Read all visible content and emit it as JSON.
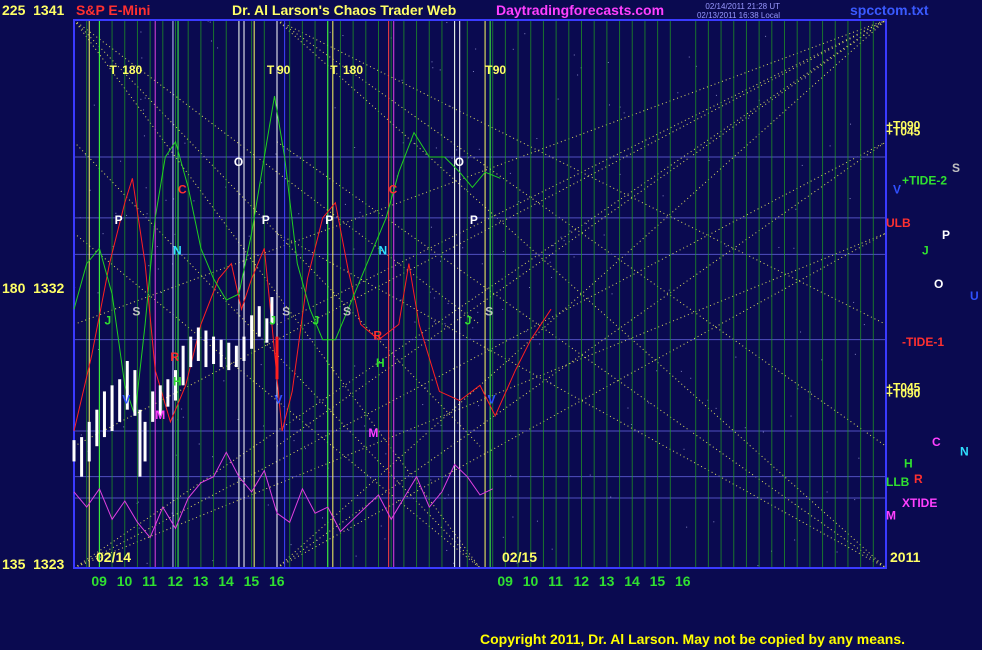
{
  "header": {
    "symbol": "S&P E-Mini",
    "title": "Dr. Al Larson's Chaos Trader Web",
    "site": "Daytradingforecasts.com",
    "timestamp_1": "02/14/2011 21:28 UT",
    "timestamp_2": "02/13/2011 16:38 Local",
    "filename": "spcctom.txt"
  },
  "y_labels": [
    {
      "angle": "225",
      "price": "1341"
    },
    {
      "angle": "180",
      "price": "1332"
    },
    {
      "angle": "135",
      "price": "1323"
    }
  ],
  "dates": [
    "02/14",
    "02/15"
  ],
  "year": "2011",
  "copyright": "Copyright 2011, Dr. Al Larson. May not be copied by any means.",
  "colors": {
    "background": "#0a0a50",
    "frame": "#3a3aff",
    "price_bar": "#ffffff",
    "price_down": "#ff2020",
    "red_line": "#ff2020",
    "green_line": "#20d020",
    "magenta_line": "#e040e0",
    "dotted_lines": "#e0e060",
    "hour_grid": "#20a020"
  },
  "chart_data": {
    "type": "bar",
    "ylim": [
      1323,
      1341
    ],
    "y_ticks": [
      1323,
      1332,
      1341
    ],
    "days": [
      "02/14",
      "02/15"
    ],
    "x_ticks": [
      "09",
      "10",
      "11",
      "12",
      "13",
      "14",
      "15",
      "16",
      "09",
      "10",
      "11",
      "12",
      "13",
      "14",
      "15",
      "16"
    ],
    "x_range_hours": [
      8.0,
      40.0
    ],
    "price_series": [
      {
        "t": 8.0,
        "low": 1326.5,
        "high": 1327.2
      },
      {
        "t": 8.3,
        "low": 1326.0,
        "high": 1327.3
      },
      {
        "t": 8.6,
        "low": 1326.5,
        "high": 1327.8
      },
      {
        "t": 8.9,
        "low": 1327.0,
        "high": 1328.2
      },
      {
        "t": 9.2,
        "low": 1327.3,
        "high": 1328.8
      },
      {
        "t": 9.5,
        "low": 1327.5,
        "high": 1329.0
      },
      {
        "t": 9.8,
        "low": 1327.8,
        "high": 1329.2
      },
      {
        "t": 10.1,
        "low": 1328.2,
        "high": 1329.8
      },
      {
        "t": 10.4,
        "low": 1328.0,
        "high": 1329.5
      },
      {
        "t": 10.6,
        "low": 1326.0,
        "high": 1328.2
      },
      {
        "t": 10.8,
        "low": 1326.5,
        "high": 1327.8
      },
      {
        "t": 11.1,
        "low": 1327.8,
        "high": 1328.8
      },
      {
        "t": 11.4,
        "low": 1328.0,
        "high": 1329.0
      },
      {
        "t": 11.7,
        "low": 1328.3,
        "high": 1329.2
      },
      {
        "t": 12.0,
        "low": 1328.5,
        "high": 1329.5
      },
      {
        "t": 12.3,
        "low": 1329.0,
        "high": 1330.3
      },
      {
        "t": 12.6,
        "low": 1329.6,
        "high": 1330.6
      },
      {
        "t": 12.9,
        "low": 1329.8,
        "high": 1330.9
      },
      {
        "t": 13.2,
        "low": 1329.6,
        "high": 1330.8
      },
      {
        "t": 13.5,
        "low": 1329.7,
        "high": 1330.6
      },
      {
        "t": 13.8,
        "low": 1329.6,
        "high": 1330.5
      },
      {
        "t": 14.1,
        "low": 1329.5,
        "high": 1330.4
      },
      {
        "t": 14.4,
        "low": 1329.6,
        "high": 1330.3
      },
      {
        "t": 14.7,
        "low": 1329.8,
        "high": 1330.6
      },
      {
        "t": 15.0,
        "low": 1330.2,
        "high": 1331.3
      },
      {
        "t": 15.3,
        "low": 1330.6,
        "high": 1331.6
      },
      {
        "t": 15.6,
        "low": 1330.4,
        "high": 1331.2
      },
      {
        "t": 15.8,
        "low": 1331.0,
        "high": 1331.9
      },
      {
        "t": 16.0,
        "low": 1329.2,
        "high": 1330.6
      }
    ],
    "series": [
      {
        "color": "red",
        "points": [
          [
            8.0,
            1327.5
          ],
          [
            8.7,
            1330.0
          ],
          [
            9.4,
            1333.0
          ],
          [
            10.0,
            1335.0
          ],
          [
            10.3,
            1335.8
          ],
          [
            10.8,
            1333.0
          ],
          [
            11.2,
            1329.5
          ],
          [
            11.8,
            1327.8
          ],
          [
            12.4,
            1329.0
          ],
          [
            13.0,
            1331.0
          ],
          [
            13.7,
            1332.5
          ],
          [
            14.2,
            1333.0
          ],
          [
            14.6,
            1331.5
          ],
          [
            15.0,
            1332.5
          ],
          [
            15.5,
            1333.5
          ],
          [
            15.8,
            1331.0
          ],
          [
            16.2,
            1327.5
          ],
          [
            16.6,
            1328.8
          ],
          [
            17.2,
            1332.5
          ],
          [
            17.8,
            1334.5
          ],
          [
            18.3,
            1335.0
          ],
          [
            18.8,
            1332.8
          ],
          [
            19.3,
            1331.0
          ],
          [
            20.0,
            1330.5
          ],
          [
            20.8,
            1331.0
          ],
          [
            21.2,
            1333.0
          ],
          [
            21.6,
            1331.0
          ],
          [
            22.4,
            1328.8
          ],
          [
            23.2,
            1328.5
          ],
          [
            24.0,
            1329.0
          ],
          [
            24.6,
            1328.0
          ],
          [
            25.4,
            1329.5
          ],
          [
            26.0,
            1330.5
          ],
          [
            26.8,
            1331.5
          ]
        ]
      },
      {
        "color": "green",
        "points": [
          [
            8.0,
            1331.5
          ],
          [
            8.5,
            1333.0
          ],
          [
            9.0,
            1333.5
          ],
          [
            9.5,
            1332.0
          ],
          [
            10.0,
            1329.0
          ],
          [
            10.4,
            1328.0
          ],
          [
            10.8,
            1331.0
          ],
          [
            11.2,
            1334.5
          ],
          [
            11.6,
            1336.5
          ],
          [
            12.0,
            1337.0
          ],
          [
            12.5,
            1335.5
          ],
          [
            13.0,
            1333.5
          ],
          [
            13.5,
            1332.5
          ],
          [
            14.0,
            1331.8
          ],
          [
            14.5,
            1332.0
          ],
          [
            15.0,
            1334.0
          ],
          [
            15.5,
            1336.5
          ],
          [
            15.9,
            1338.5
          ],
          [
            16.3,
            1336.5
          ],
          [
            16.8,
            1333.0
          ],
          [
            17.3,
            1331.5
          ],
          [
            17.8,
            1330.5
          ],
          [
            18.3,
            1330.5
          ],
          [
            18.8,
            1331.5
          ],
          [
            19.3,
            1332.5
          ],
          [
            19.8,
            1333.5
          ],
          [
            20.3,
            1334.5
          ],
          [
            20.8,
            1336.0
          ],
          [
            21.4,
            1337.3
          ],
          [
            22.0,
            1336.5
          ],
          [
            22.6,
            1336.5
          ],
          [
            23.2,
            1336.0
          ],
          [
            23.7,
            1335.5
          ],
          [
            24.2,
            1336.0
          ],
          [
            24.8,
            1335.8
          ]
        ]
      },
      {
        "color": "magenta",
        "points": [
          [
            8.0,
            1325.5
          ],
          [
            8.5,
            1325.0
          ],
          [
            9.0,
            1325.6
          ],
          [
            9.5,
            1324.6
          ],
          [
            10.0,
            1325.2
          ],
          [
            10.5,
            1324.5
          ],
          [
            11.0,
            1324.0
          ],
          [
            11.5,
            1325.0
          ],
          [
            12.0,
            1324.3
          ],
          [
            12.5,
            1325.3
          ],
          [
            13.0,
            1325.8
          ],
          [
            13.5,
            1326.0
          ],
          [
            14.0,
            1326.8
          ],
          [
            14.5,
            1326.0
          ],
          [
            15.0,
            1325.5
          ],
          [
            15.5,
            1326.2
          ],
          [
            16.0,
            1324.8
          ],
          [
            16.5,
            1324.5
          ],
          [
            17.0,
            1325.6
          ],
          [
            17.5,
            1324.8
          ],
          [
            18.0,
            1325.0
          ],
          [
            18.5,
            1324.2
          ],
          [
            19.0,
            1324.6
          ],
          [
            19.5,
            1325.0
          ],
          [
            20.0,
            1325.4
          ],
          [
            20.5,
            1324.6
          ],
          [
            21.0,
            1325.3
          ],
          [
            21.5,
            1326.0
          ],
          [
            22.0,
            1325.0
          ],
          [
            22.5,
            1325.5
          ],
          [
            23.0,
            1326.4
          ],
          [
            23.5,
            1326.0
          ],
          [
            24.0,
            1325.4
          ],
          [
            24.5,
            1325.6
          ]
        ]
      }
    ],
    "vertical_labels": [
      {
        "text": "T",
        "t": 9.4,
        "color": "yellow"
      },
      {
        "text": "180",
        "t": 9.9,
        "color": "yellow"
      },
      {
        "text": "T",
        "t": 15.6,
        "color": "yellow"
      },
      {
        "text": "90",
        "t": 16.0,
        "color": "yellow"
      },
      {
        "text": "T",
        "t": 18.1,
        "color": "yellow"
      },
      {
        "text": "180",
        "t": 18.6,
        "color": "yellow"
      },
      {
        "text": "T",
        "t": 24.2,
        "color": "yellow"
      },
      {
        "text": "90",
        "t": 24.5,
        "color": "yellow"
      }
    ],
    "annotations": [
      {
        "text": "P",
        "t": 9.6,
        "price": 1334.3,
        "color": "white"
      },
      {
        "text": "S",
        "t": 10.3,
        "price": 1331.3,
        "color": "#c0c0c0"
      },
      {
        "text": "J",
        "t": 9.2,
        "price": 1331.0,
        "color": "green"
      },
      {
        "text": "V",
        "t": 9.9,
        "price": 1328.4,
        "color": "blue"
      },
      {
        "text": "C",
        "t": 12.1,
        "price": 1335.3,
        "color": "red"
      },
      {
        "text": "N",
        "t": 11.9,
        "price": 1333.3,
        "color": "cyan"
      },
      {
        "text": "R",
        "t": 11.8,
        "price": 1329.8,
        "color": "red"
      },
      {
        "text": "H",
        "t": 11.9,
        "price": 1329.0,
        "color": "green"
      },
      {
        "text": "M",
        "t": 11.2,
        "price": 1327.9,
        "color": "magenta"
      },
      {
        "text": "O",
        "t": 14.3,
        "price": 1336.2,
        "color": "white"
      },
      {
        "text": "P",
        "t": 15.4,
        "price": 1334.3,
        "color": "white"
      },
      {
        "text": "S",
        "t": 16.2,
        "price": 1331.3,
        "color": "#c0c0c0"
      },
      {
        "text": "J",
        "t": 15.7,
        "price": 1331.0,
        "color": "green"
      },
      {
        "text": "V",
        "t": 15.9,
        "price": 1328.4,
        "color": "blue"
      },
      {
        "text": "P",
        "t": 17.9,
        "price": 1334.3,
        "color": "white"
      },
      {
        "text": "S",
        "t": 18.6,
        "price": 1331.3,
        "color": "#c0c0c0"
      },
      {
        "text": "J",
        "t": 17.4,
        "price": 1331.0,
        "color": "green"
      },
      {
        "text": "C",
        "t": 20.4,
        "price": 1335.3,
        "color": "red"
      },
      {
        "text": "N",
        "t": 20.0,
        "price": 1333.3,
        "color": "cyan"
      },
      {
        "text": "R",
        "t": 19.8,
        "price": 1330.5,
        "color": "red"
      },
      {
        "text": "H",
        "t": 19.9,
        "price": 1329.6,
        "color": "green"
      },
      {
        "text": "M",
        "t": 19.6,
        "price": 1327.3,
        "color": "magenta"
      },
      {
        "text": "O",
        "t": 23.0,
        "price": 1336.2,
        "color": "white"
      },
      {
        "text": "P",
        "t": 23.6,
        "price": 1334.3,
        "color": "white"
      },
      {
        "text": "S",
        "t": 24.2,
        "price": 1331.3,
        "color": "#c0c0c0"
      },
      {
        "text": "J",
        "t": 23.4,
        "price": 1331.0,
        "color": "green"
      },
      {
        "text": "V",
        "t": 24.3,
        "price": 1328.4,
        "color": "blue"
      }
    ],
    "right_labels": [
      {
        "text": "+T090",
        "price": 1337.4,
        "color": "yellow"
      },
      {
        "text": "+T045",
        "price": 1337.2,
        "color": "yellow"
      },
      {
        "text": "S",
        "price": 1336.0,
        "color": "#c0c0c0"
      },
      {
        "text": "+TIDE-2",
        "price": 1335.6,
        "color": "green"
      },
      {
        "text": "V",
        "price": 1335.3,
        "color": "blue"
      },
      {
        "text": "ULB",
        "price": 1334.2,
        "color": "red"
      },
      {
        "text": "P",
        "price": 1333.8,
        "color": "white"
      },
      {
        "text": "J",
        "price": 1333.3,
        "color": "green"
      },
      {
        "text": "O",
        "price": 1332.2,
        "color": "white"
      },
      {
        "text": "U",
        "price": 1331.8,
        "color": "blue"
      },
      {
        "text": "-TIDE-1",
        "price": 1330.3,
        "color": "red"
      },
      {
        "text": "+T045",
        "price": 1328.8,
        "color": "yellow"
      },
      {
        "text": "+T090",
        "price": 1328.6,
        "color": "yellow"
      },
      {
        "text": "C",
        "price": 1327.0,
        "color": "magenta"
      },
      {
        "text": "N",
        "price": 1326.7,
        "color": "cyan"
      },
      {
        "text": "H",
        "price": 1326.3,
        "color": "green"
      },
      {
        "text": "LLB",
        "price": 1325.7,
        "color": "green"
      },
      {
        "text": "R",
        "price": 1325.8,
        "color": "red"
      },
      {
        "text": "XTIDE",
        "price": 1325.0,
        "color": "magenta"
      },
      {
        "text": "M",
        "price": 1324.6,
        "color": "magenta"
      }
    ]
  }
}
